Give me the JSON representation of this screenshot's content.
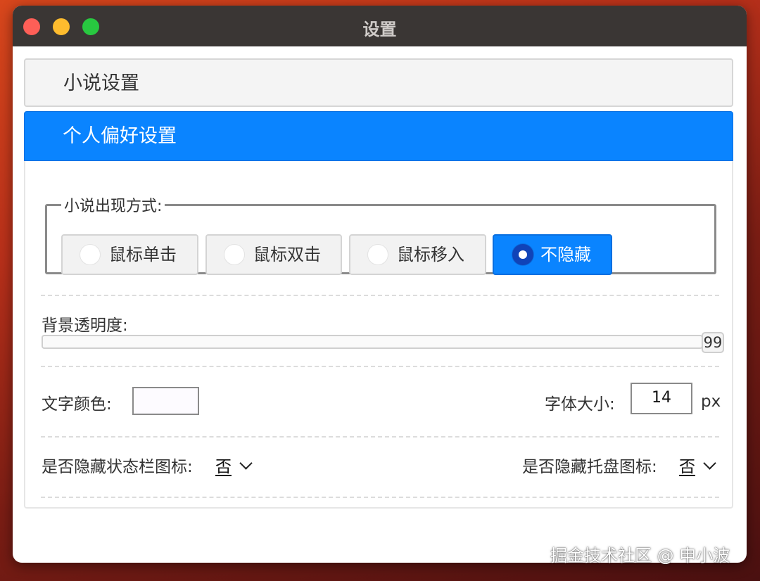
{
  "window": {
    "title": "设置"
  },
  "accordion": {
    "section1_label": "小说设置",
    "section2_label": "个人偏好设置"
  },
  "appear_mode": {
    "legend": "小说出现方式:",
    "options": [
      "鼠标单击",
      "鼠标双击",
      "鼠标移入",
      "不隐藏"
    ],
    "selected": "不隐藏"
  },
  "opacity": {
    "label": "背景透明度:",
    "value": "99"
  },
  "text_color": {
    "label": "文字颜色:",
    "value": "#fdfbff"
  },
  "font_size": {
    "label": "字体大小:",
    "value": "14",
    "unit": "px"
  },
  "hide_status_icon": {
    "label": "是否隐藏状态栏图标:",
    "value": "否"
  },
  "hide_tray_icon": {
    "label": "是否隐藏托盘图标:",
    "value": "否"
  },
  "watermark": "掘金技术社区 @ 申小波",
  "colors": {
    "accent": "#0a84ff",
    "titlebar": "#3a3634"
  }
}
